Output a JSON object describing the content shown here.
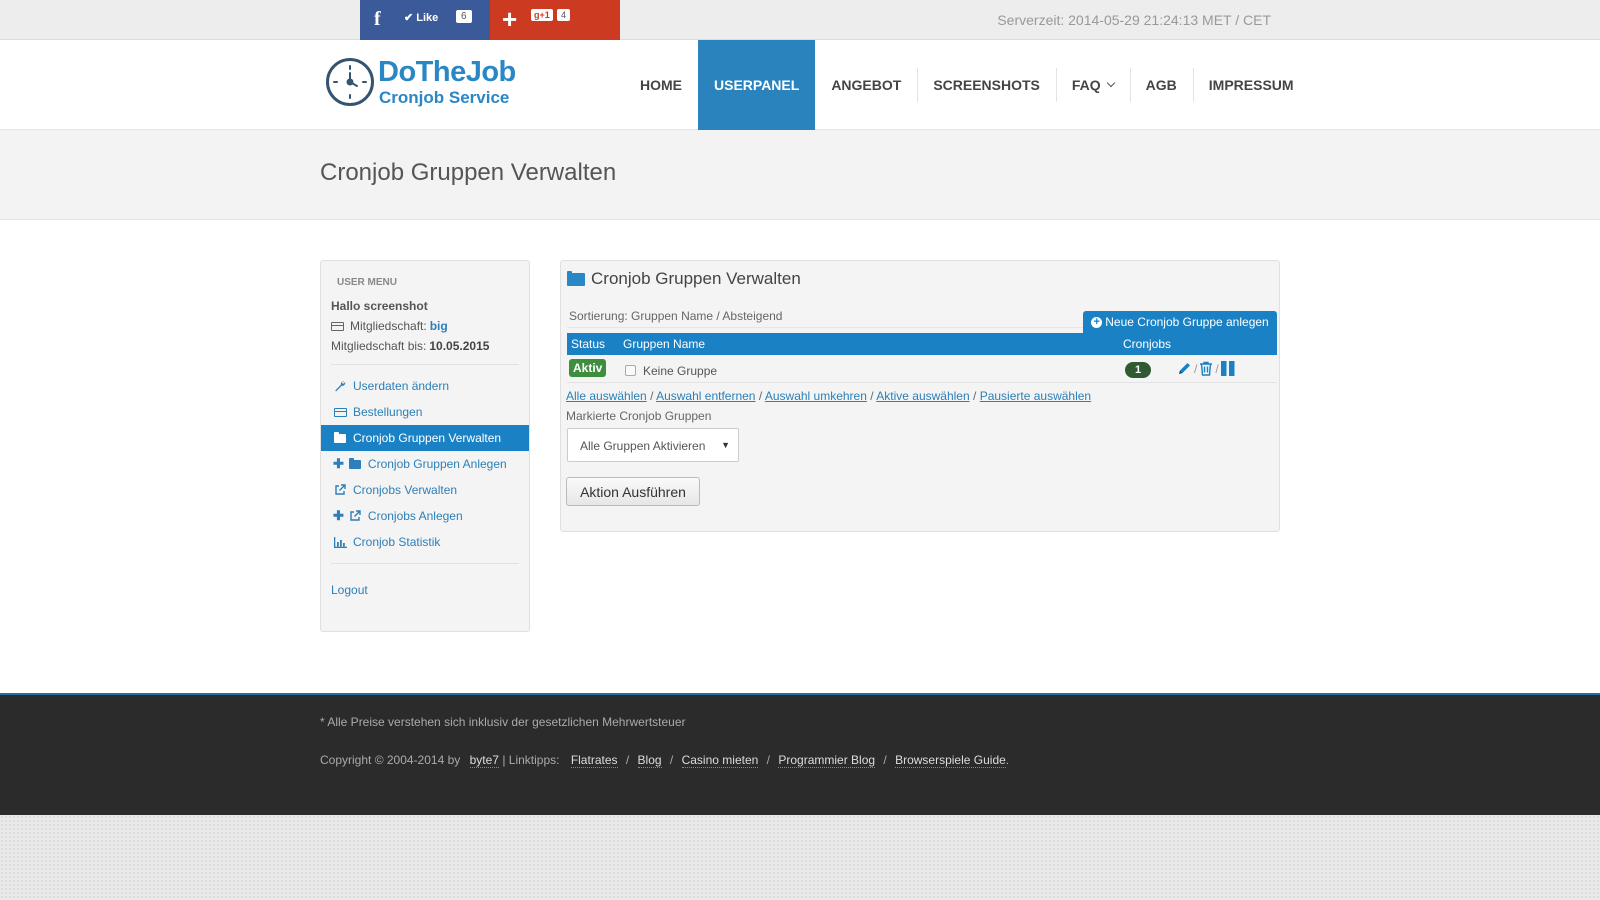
{
  "topbar": {
    "fb_icon": "f",
    "like_label": "✔ Like",
    "like_count": "6",
    "gplus_icon": "+",
    "gplus_badge": "g+1",
    "gplus_count": "4",
    "servertime": "Serverzeit: 2014-05-29 21:24:13 MET / CET",
    "fb_color": "#3b5a9a",
    "gplus_color": "#cc3a22"
  },
  "header": {
    "logo_title": "DoTheJob",
    "logo_sub": "Cronjob Service",
    "nav": [
      {
        "label": "HOME"
      },
      {
        "label": "USERPANEL"
      },
      {
        "label": "ANGEBOT"
      },
      {
        "label": "SCREENSHOTS"
      },
      {
        "label": "FAQ"
      },
      {
        "label": "AGB"
      },
      {
        "label": "IMPRESSUM"
      }
    ],
    "accent": "#2b83bd"
  },
  "page": {
    "title": "Cronjob Gruppen Verwalten"
  },
  "sidebar": {
    "heading": "USER MENU",
    "hello": "Hallo screenshot",
    "membership_label": "Mitgliedschaft:",
    "membership_value": "big",
    "until_label": "Mitgliedschaft bis:",
    "until_value": "10.05.2015",
    "links": [
      {
        "label": "Userdaten ändern",
        "icon": "wrench-icon"
      },
      {
        "label": "Bestellungen",
        "icon": "credit-card-icon"
      },
      {
        "label": "Cronjob Gruppen Verwalten",
        "icon": "folder-icon"
      },
      {
        "label": "Cronjob Gruppen Anlegen",
        "icon": "folder-icon"
      },
      {
        "label": "Cronjobs Verwalten",
        "icon": "external-link-icon"
      },
      {
        "label": "Cronjobs Anlegen",
        "icon": "external-link-icon"
      },
      {
        "label": "Cronjob Statistik",
        "icon": "bar-chart-icon"
      }
    ],
    "logout": "Logout"
  },
  "panel": {
    "title": "Cronjob Gruppen Verwalten",
    "sort": "Sortierung: Gruppen Name / Absteigend",
    "new_button": "Neue Cronjob Gruppe anlegen",
    "columns": {
      "status": "Status",
      "name": "Gruppen Name",
      "count": "Cronjobs"
    },
    "rows": [
      {
        "status": "Aktiv",
        "name": "Keine Gruppe",
        "count": "1"
      }
    ],
    "select_links": [
      "Alle auswählen",
      "Auswahl entfernen",
      "Auswahl umkehren",
      "Aktive auswählen",
      "Pausierte auswählen"
    ],
    "separator": "/",
    "marked_label": "Markierte Cronjob Gruppen",
    "action_select": "Alle Gruppen Aktivieren",
    "exec_button": "Aktion Ausführen"
  },
  "footer": {
    "note": "* Alle Preise verstehen sich inklusiv der gesetzlichen Mehrwertsteuer",
    "copyright": "Copyright © 2004-2014 by",
    "byte7": "byte7",
    "linktipps": "| Linktipps:",
    "links": [
      "Flatrates",
      "Blog",
      "Casino mieten",
      "Programmier Blog",
      "Browserspiele Guide"
    ],
    "link_sep": "/",
    "end": "."
  }
}
